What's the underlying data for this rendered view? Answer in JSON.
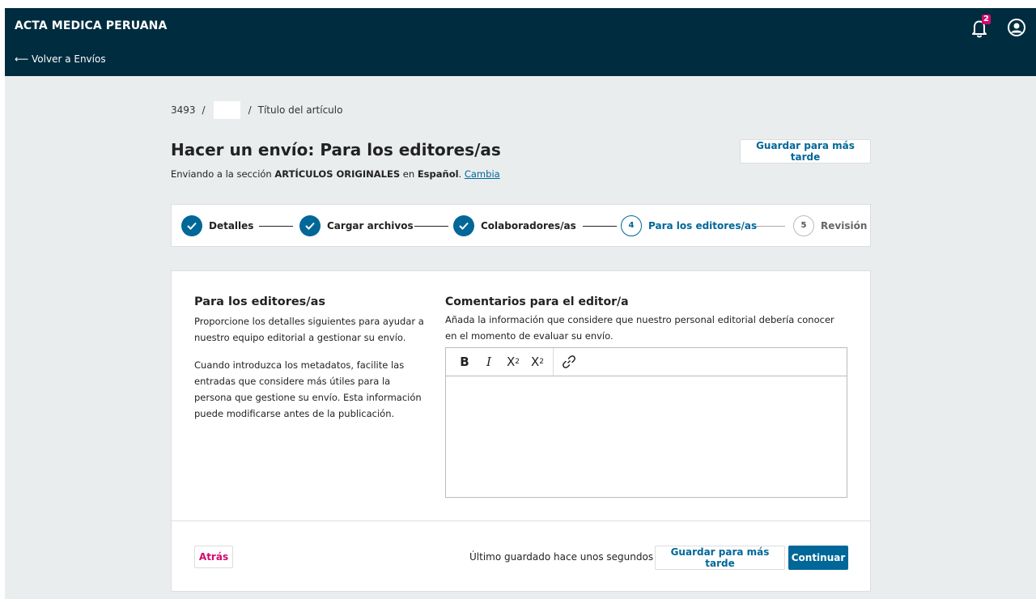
{
  "header": {
    "site_title": "ACTA MEDICA PERUANA",
    "back_link": "⟵ Volver a Envíos",
    "notification_count": "2",
    "icons": [
      "bell-icon",
      "user-circle-icon"
    ]
  },
  "breadcrumb": {
    "id": "3493",
    "separator": "/",
    "title": "Título del artículo"
  },
  "page": {
    "title": "Hacer un envío: Para los editores/as",
    "sub_prefix": "Enviando a la sección ",
    "section": "ARTÍCULOS ORIGINALES",
    "sub_middle": " en ",
    "language": "Español",
    "sub_dot": ". ",
    "change_link": "Cambia",
    "save_later": "Guardar para más tarde"
  },
  "steps": [
    {
      "label": "Detalles",
      "state": "done"
    },
    {
      "label": "Cargar archivos",
      "state": "done"
    },
    {
      "label": "Colaboradores/as",
      "state": "done"
    },
    {
      "number": "4",
      "label": "Para los editores/as",
      "state": "active"
    },
    {
      "number": "5",
      "label": "Revisión",
      "state": "pending"
    }
  ],
  "left": {
    "heading": "Para los editores/as",
    "para1": "Proporcione los detalles siguientes para ayudar a nuestro equipo editorial a gestionar su envío.",
    "para2": "Cuando introduzca los metadatos, facilite las entradas que considere más útiles para la persona que gestione su envío. Esta información puede modificarse antes de la publicación."
  },
  "right": {
    "heading": "Comentarios para el editor/a",
    "description": "Añada la información que considere que nuestro personal editorial debería conocer en el momento de evaluar su envío.",
    "editor_value": "",
    "toolbar": [
      {
        "name": "bold-icon",
        "glyph": "B"
      },
      {
        "name": "italic-icon",
        "glyph": "I"
      },
      {
        "name": "superscript-icon",
        "glyph": "X",
        "mod": "2"
      },
      {
        "name": "subscript-icon",
        "glyph": "X",
        "mod": "2"
      },
      {
        "name": "link-icon"
      }
    ]
  },
  "footer": {
    "back_label": "Atrás",
    "saved_status": "Último guardado hace unos segundos",
    "save_label": "Guardar para más tarde",
    "continue_label": "Continuar"
  },
  "colors": {
    "header_bg": "#002c40",
    "accent": "#006798",
    "danger": "#d00a6c",
    "page_bg": "#eaedee"
  }
}
